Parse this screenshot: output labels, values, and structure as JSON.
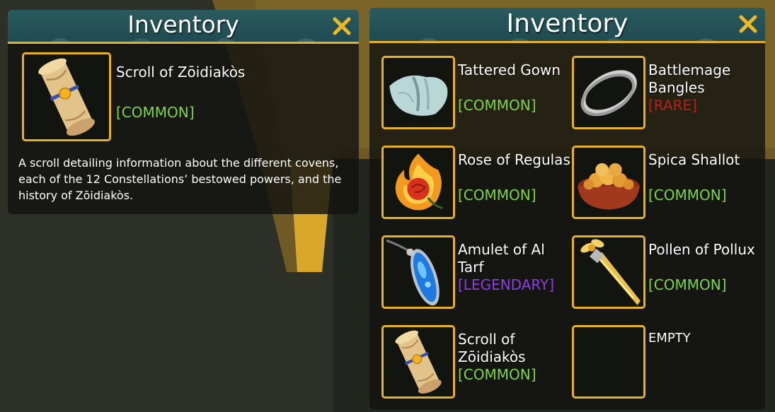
{
  "colors": {
    "accent_gold": "#e6b128",
    "header_teal": "#1f4b52",
    "common": "#7fd547",
    "rare": "#b81f1f",
    "legendary": "#8e3fe0"
  },
  "detail_panel": {
    "title": "Inventory",
    "close_icon": "close-icon",
    "item": {
      "name": "Scroll of Zōidiakòs",
      "rarity": "[COMMON]",
      "icon": "scroll-icon",
      "description": "A scroll detailing information about the different covens, each of the 12 Constellations’ bestowed powers, and the history of Zōidiakòs."
    }
  },
  "inventory_panel": {
    "title": "Inventory",
    "close_icon": "close-icon",
    "slots": [
      {
        "name": "Tattered Gown",
        "rarity": "[COMMON]",
        "rarity_tier": "common",
        "icon": "gown-icon"
      },
      {
        "name": "Battlemage Bangles",
        "rarity": "[RARE]",
        "rarity_tier": "rare",
        "icon": "bangles-icon"
      },
      {
        "name": "Rose of Regulas",
        "rarity": "[COMMON]",
        "rarity_tier": "common",
        "icon": "fire-rose-icon"
      },
      {
        "name": "Spica Shallot",
        "rarity": "[COMMON]",
        "rarity_tier": "common",
        "icon": "shallot-bowl-icon"
      },
      {
        "name": "Amulet of Al Tarf",
        "rarity": "[LEGENDARY]",
        "rarity_tier": "legendary",
        "icon": "amulet-icon"
      },
      {
        "name": "Pollen of Pollux",
        "rarity": "[COMMON]",
        "rarity_tier": "common",
        "icon": "pollen-wand-icon"
      },
      {
        "name": "Scroll of Zōidiakòs",
        "rarity": "[COMMON]",
        "rarity_tier": "common",
        "icon": "scroll-icon"
      },
      {
        "name": "EMPTY",
        "rarity": "",
        "rarity_tier": "",
        "icon": "empty-slot"
      }
    ]
  }
}
